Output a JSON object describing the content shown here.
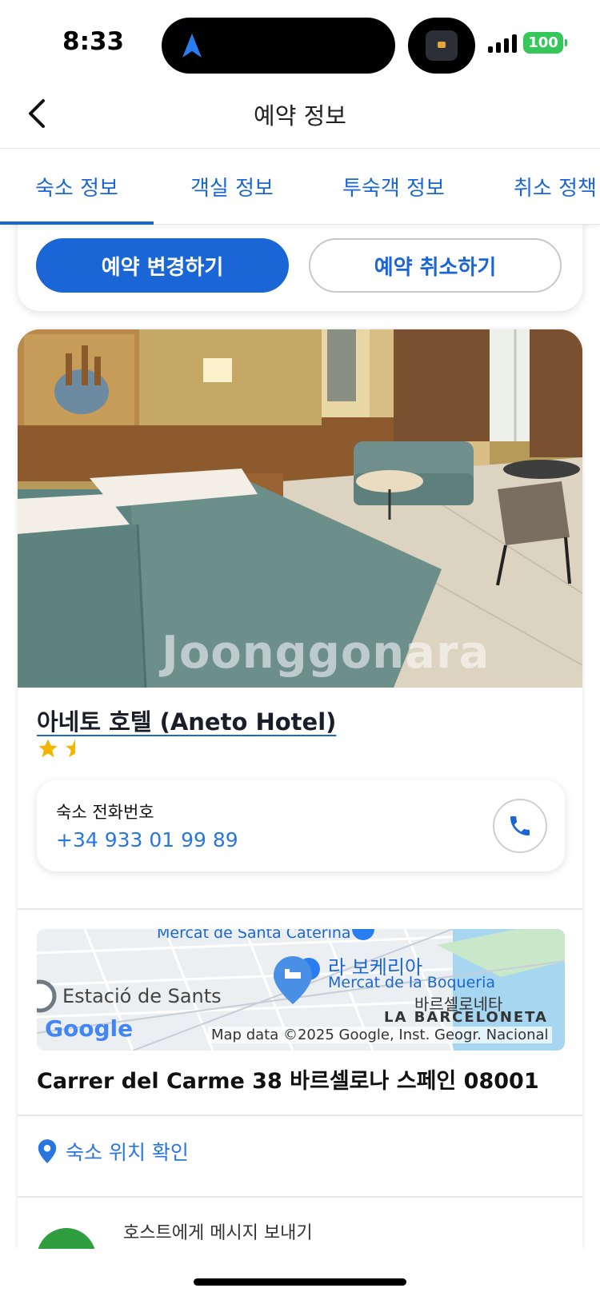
{
  "status_bar": {
    "time": "8:33",
    "battery": "100"
  },
  "header": {
    "title": "예약 정보"
  },
  "tabs": [
    {
      "label": "숙소 정보",
      "active": true
    },
    {
      "label": "객실 정보",
      "active": false
    },
    {
      "label": "투숙객 정보",
      "active": false
    },
    {
      "label": "취소 정책",
      "active": false
    }
  ],
  "actions": {
    "change_label": "예약 변경하기",
    "cancel_label": "예약 취소하기"
  },
  "hotel": {
    "photo_watermark": "Joonggonara",
    "name": "아네토 호텔 (Aneto Hotel)",
    "rating_stars": 2.5,
    "phone_label": "숙소 전화번호",
    "phone_number": "+34 933 01 99 89",
    "address": "Carrer del Carme 38 바르셀로나 스페인 08001",
    "location_link": "숙소 위치 확인",
    "host_message": "호스트에게 메시지 보내기"
  },
  "map": {
    "labels": {
      "top": "Mercat de Santa Caterina",
      "boqueria_kr": "라 보케리아",
      "boqueria_en": "Mercat de la Boqueria",
      "sants": "Estació de Sants",
      "barceloneta_kr": "바르셀로네타",
      "barceloneta_en": "LA BARCELONETA",
      "google": "Google",
      "attribution": "Map data ©2025 Google, Inst. Geogr. Nacional"
    }
  },
  "colors": {
    "accent": "#1a66d6",
    "link": "#2a76e0",
    "battery": "#35c759"
  }
}
